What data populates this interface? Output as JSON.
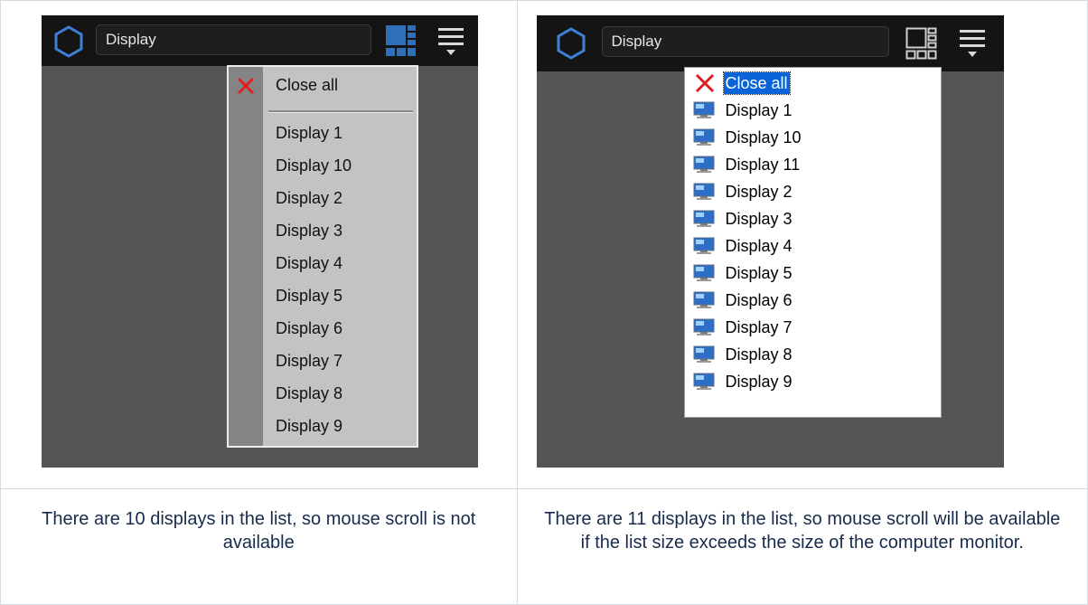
{
  "left_panel": {
    "search_value": "Display",
    "menu": {
      "close_all": "Close all",
      "items": [
        "Display 1",
        "Display 10",
        "Display 2",
        "Display 3",
        "Display 4",
        "Display 5",
        "Display 6",
        "Display 7",
        "Display 8",
        "Display 9"
      ]
    },
    "caption": "There are 10 displays in the list, so mouse scroll is not available"
  },
  "right_panel": {
    "search_value": "Display",
    "menu": {
      "close_all": "Close all",
      "items": [
        "Display 1",
        "Display 10",
        "Display 11",
        "Display 2",
        "Display 3",
        "Display 4",
        "Display 5",
        "Display 6",
        "Display 7",
        "Display 8",
        "Display 9"
      ]
    },
    "caption": "There are 11 displays in the list, so mouse scroll will be available if the list size exceeds the size of the computer monitor."
  },
  "colors": {
    "accent_blue": "#3d7fd6",
    "selection_blue": "#0a64d8",
    "close_red": "#e02020",
    "caption_text": "#172b4d"
  }
}
